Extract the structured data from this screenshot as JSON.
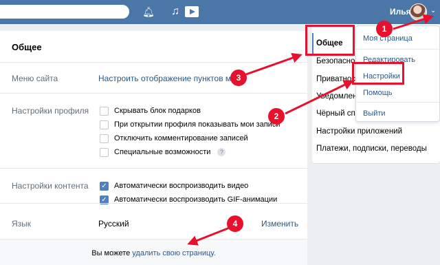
{
  "header": {
    "search_placeholder": "",
    "user_name": "Илья",
    "icons": [
      "bell-icon",
      "music-icon",
      "video-icon"
    ]
  },
  "card": {
    "title": "Общее",
    "menu": {
      "label": "Меню сайта",
      "link": "Настроить отображение пунктов меню"
    },
    "profile": {
      "label": "Настройки профиля",
      "options": [
        "Скрывать блок подарков",
        "При открытии профиля показывать мои записи",
        "Отключить комментирование записей",
        "Специальные возможности"
      ],
      "help": "?"
    },
    "content": {
      "label": "Настройки контента",
      "options": [
        "Автоматически воспроизводить видео",
        "Автоматически воспроизводить GIF-анимации"
      ]
    },
    "language": {
      "label": "Язык",
      "value": "Русский",
      "action": "Изменить"
    },
    "footer": {
      "prefix": "Вы можете",
      "link": "удалить свою страницу."
    }
  },
  "right_nav": {
    "items": [
      "Общее",
      "Безопасность",
      "Приватность",
      "Уведомления",
      "Чёрный список",
      "Настройки приложений",
      "Платежи, подписки, переводы"
    ]
  },
  "dropdown": {
    "items": [
      "Моя страница",
      "Редактировать",
      "Настройки",
      "Помощь",
      "Выйти"
    ]
  },
  "annotations": {
    "badges": [
      "1",
      "2",
      "3",
      "4"
    ],
    "color": "#e8112d"
  },
  "colors": {
    "header": "#4a76a8",
    "link": "#2a5885",
    "checkbox": "#5181b8"
  }
}
